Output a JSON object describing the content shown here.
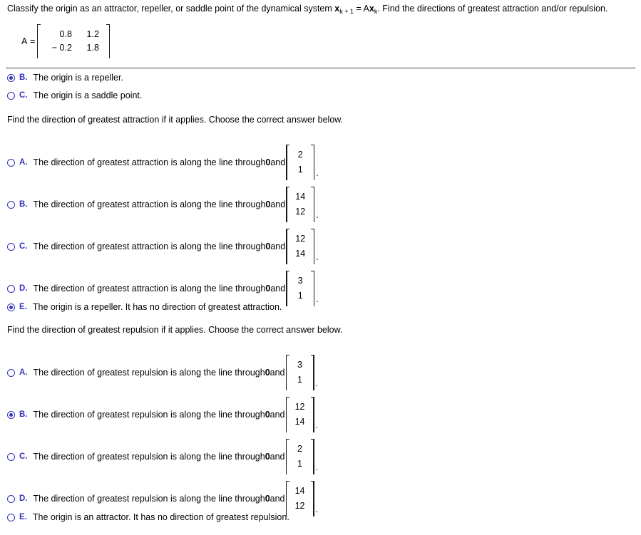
{
  "prompt": {
    "part1": "Classify the origin as an attractor, repeller, or saddle point of the dynamical system ",
    "x_var": "x",
    "sub1": "k + 1",
    "equals": " = A",
    "x_var2": "x",
    "sub2": "k",
    "part2": ". Find the directions of greatest attraction and/or repulsion."
  },
  "matrix": {
    "label": "A =",
    "rows": [
      [
        "0.8",
        "1.2"
      ],
      [
        "− 0.2",
        "1.8"
      ]
    ]
  },
  "colors": {
    "option_blue": "#3333bb",
    "divider": "#3c4250",
    "text": "#000000"
  },
  "classify_options": [
    {
      "letter": "B.",
      "text": "The origin is a repeller.",
      "selected": true
    },
    {
      "letter": "C.",
      "text": "The origin is a saddle point.",
      "selected": false
    }
  ],
  "attraction": {
    "question": "Find the direction of greatest attraction if it applies. Choose the correct answer below.",
    "options": [
      {
        "letter": "A.",
        "text_before": "The direction of greatest attraction is along the line through ",
        "zero": "0",
        "text_after": " and ",
        "vector": [
          "2",
          "1"
        ],
        "period": ".",
        "selected": false
      },
      {
        "letter": "B.",
        "text_before": "The direction of greatest attraction is along the line through ",
        "zero": "0",
        "text_after": " and ",
        "vector": [
          "14",
          "12"
        ],
        "period": ".",
        "selected": false
      },
      {
        "letter": "C.",
        "text_before": "The direction of greatest attraction is along the line through ",
        "zero": "0",
        "text_after": " and ",
        "vector": [
          "12",
          "14"
        ],
        "period": ".",
        "selected": false
      },
      {
        "letter": "D.",
        "text_before": "The direction of greatest attraction is along the line through ",
        "zero": "0",
        "text_after": " and ",
        "vector": [
          "3",
          "1"
        ],
        "period": ".",
        "selected": false
      },
      {
        "letter": "E.",
        "text_plain": "The origin is a repeller. It has no direction of greatest attraction.",
        "selected": true
      }
    ]
  },
  "repulsion": {
    "question": "Find the direction of greatest repulsion if it applies. Choose the correct answer below.",
    "options": [
      {
        "letter": "A.",
        "text_before": "The direction of greatest repulsion is along the line through ",
        "zero": "0",
        "text_after": " and ",
        "vector": [
          "3",
          "1"
        ],
        "period": ".",
        "selected": false
      },
      {
        "letter": "B.",
        "text_before": "The direction of greatest repulsion is along the line through ",
        "zero": "0",
        "text_after": " and ",
        "vector": [
          "12",
          "14"
        ],
        "period": ".",
        "selected": true
      },
      {
        "letter": "C.",
        "text_before": "The direction of greatest repulsion is along the line through ",
        "zero": "0",
        "text_after": " and ",
        "vector": [
          "2",
          "1"
        ],
        "period": ".",
        "selected": false
      },
      {
        "letter": "D.",
        "text_before": "The direction of greatest repulsion is along the line through ",
        "zero": "0",
        "text_after": " and ",
        "vector": [
          "14",
          "12"
        ],
        "period": ".",
        "selected": false
      },
      {
        "letter": "E.",
        "text_plain": "The origin is an attractor. It has no direction of greatest repulsion.",
        "selected": false
      }
    ]
  }
}
